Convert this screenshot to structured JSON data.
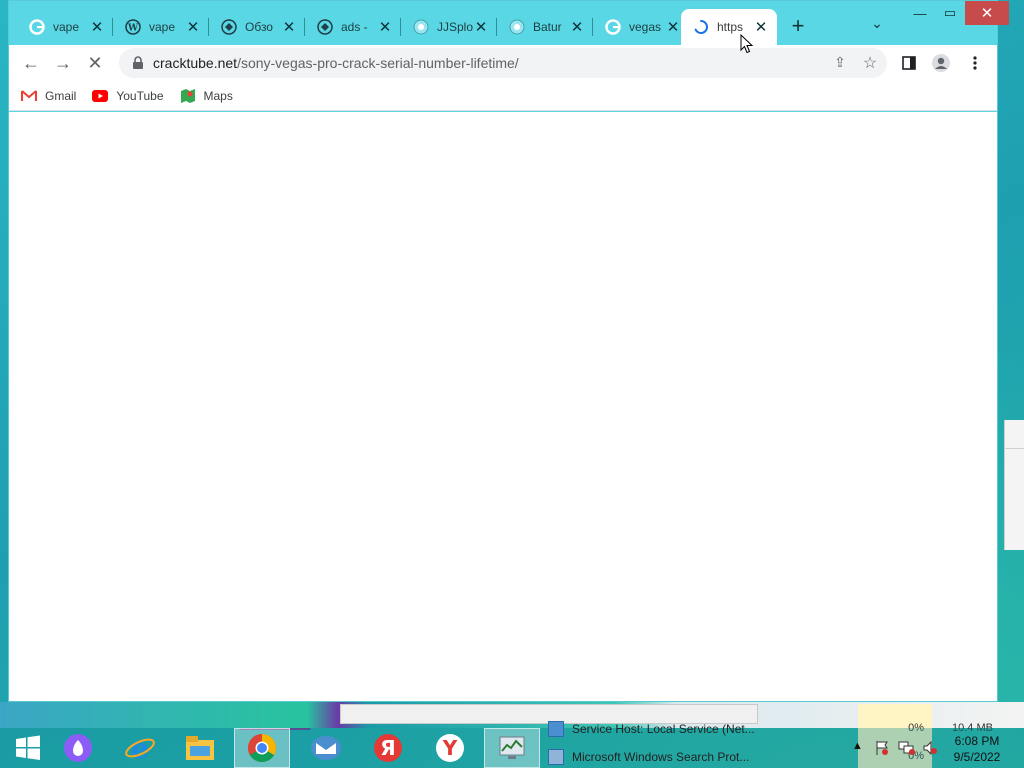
{
  "browser": {
    "tabs": [
      {
        "title": "vape",
        "icon": "google-icon"
      },
      {
        "title": "vape",
        "icon": "wordpress-icon"
      },
      {
        "title": "Обзо",
        "icon": "globe-icon"
      },
      {
        "title": "ads -",
        "icon": "globe-icon"
      },
      {
        "title": "JJSplo",
        "icon": "site-icon"
      },
      {
        "title": "Batur",
        "icon": "site-icon"
      },
      {
        "title": "vegas",
        "icon": "google-icon"
      },
      {
        "title": "https",
        "icon": "loading-spinner-icon",
        "active": true
      }
    ],
    "address": {
      "host": "cracktube.net",
      "path": "/sony-vegas-pro-crack-serial-number-lifetime/"
    },
    "bookmarks": [
      {
        "label": "Gmail",
        "icon": "gmail-icon"
      },
      {
        "label": "YouTube",
        "icon": "youtube-icon"
      },
      {
        "label": "Maps",
        "icon": "maps-icon"
      }
    ]
  },
  "background_window": {
    "rows": [
      {
        "label": "Service Host: Local Service (Net..."
      },
      {
        "label": "Microsoft Windows Search Prot..."
      }
    ],
    "cpu_values": [
      "0%",
      "0%"
    ],
    "memory_value": "10.4 MB"
  },
  "taskbar": {
    "items": [
      "start-icon",
      "alice-icon",
      "internet-explorer-icon",
      "file-explorer-icon",
      "chrome-icon",
      "mail-icon",
      "yandex-icon",
      "yandex-browser-icon",
      "task-manager-icon"
    ],
    "clock_time": "6:08 PM",
    "clock_date": "9/5/2022"
  },
  "colors": {
    "tabstrip": "#5ad7e4",
    "close_button": "#c74b4b",
    "desktop": "#1fa9b5"
  }
}
